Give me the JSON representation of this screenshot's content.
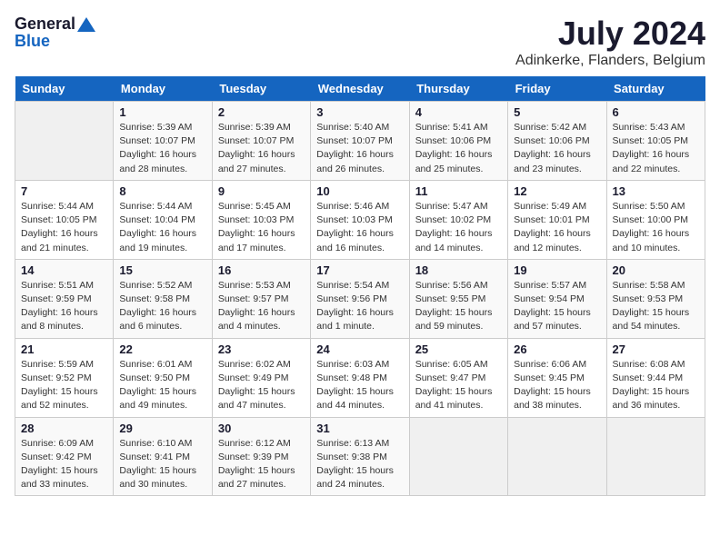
{
  "logo": {
    "general": "General",
    "blue": "Blue"
  },
  "title": {
    "month_year": "July 2024",
    "location": "Adinkerke, Flanders, Belgium"
  },
  "weekdays": [
    "Sunday",
    "Monday",
    "Tuesday",
    "Wednesday",
    "Thursday",
    "Friday",
    "Saturday"
  ],
  "weeks": [
    [
      {
        "day": "",
        "info": ""
      },
      {
        "day": "1",
        "info": "Sunrise: 5:39 AM\nSunset: 10:07 PM\nDaylight: 16 hours\nand 28 minutes."
      },
      {
        "day": "2",
        "info": "Sunrise: 5:39 AM\nSunset: 10:07 PM\nDaylight: 16 hours\nand 27 minutes."
      },
      {
        "day": "3",
        "info": "Sunrise: 5:40 AM\nSunset: 10:07 PM\nDaylight: 16 hours\nand 26 minutes."
      },
      {
        "day": "4",
        "info": "Sunrise: 5:41 AM\nSunset: 10:06 PM\nDaylight: 16 hours\nand 25 minutes."
      },
      {
        "day": "5",
        "info": "Sunrise: 5:42 AM\nSunset: 10:06 PM\nDaylight: 16 hours\nand 23 minutes."
      },
      {
        "day": "6",
        "info": "Sunrise: 5:43 AM\nSunset: 10:05 PM\nDaylight: 16 hours\nand 22 minutes."
      }
    ],
    [
      {
        "day": "7",
        "info": "Sunrise: 5:44 AM\nSunset: 10:05 PM\nDaylight: 16 hours\nand 21 minutes."
      },
      {
        "day": "8",
        "info": "Sunrise: 5:44 AM\nSunset: 10:04 PM\nDaylight: 16 hours\nand 19 minutes."
      },
      {
        "day": "9",
        "info": "Sunrise: 5:45 AM\nSunset: 10:03 PM\nDaylight: 16 hours\nand 17 minutes."
      },
      {
        "day": "10",
        "info": "Sunrise: 5:46 AM\nSunset: 10:03 PM\nDaylight: 16 hours\nand 16 minutes."
      },
      {
        "day": "11",
        "info": "Sunrise: 5:47 AM\nSunset: 10:02 PM\nDaylight: 16 hours\nand 14 minutes."
      },
      {
        "day": "12",
        "info": "Sunrise: 5:49 AM\nSunset: 10:01 PM\nDaylight: 16 hours\nand 12 minutes."
      },
      {
        "day": "13",
        "info": "Sunrise: 5:50 AM\nSunset: 10:00 PM\nDaylight: 16 hours\nand 10 minutes."
      }
    ],
    [
      {
        "day": "14",
        "info": "Sunrise: 5:51 AM\nSunset: 9:59 PM\nDaylight: 16 hours\nand 8 minutes."
      },
      {
        "day": "15",
        "info": "Sunrise: 5:52 AM\nSunset: 9:58 PM\nDaylight: 16 hours\nand 6 minutes."
      },
      {
        "day": "16",
        "info": "Sunrise: 5:53 AM\nSunset: 9:57 PM\nDaylight: 16 hours\nand 4 minutes."
      },
      {
        "day": "17",
        "info": "Sunrise: 5:54 AM\nSunset: 9:56 PM\nDaylight: 16 hours\nand 1 minute."
      },
      {
        "day": "18",
        "info": "Sunrise: 5:56 AM\nSunset: 9:55 PM\nDaylight: 15 hours\nand 59 minutes."
      },
      {
        "day": "19",
        "info": "Sunrise: 5:57 AM\nSunset: 9:54 PM\nDaylight: 15 hours\nand 57 minutes."
      },
      {
        "day": "20",
        "info": "Sunrise: 5:58 AM\nSunset: 9:53 PM\nDaylight: 15 hours\nand 54 minutes."
      }
    ],
    [
      {
        "day": "21",
        "info": "Sunrise: 5:59 AM\nSunset: 9:52 PM\nDaylight: 15 hours\nand 52 minutes."
      },
      {
        "day": "22",
        "info": "Sunrise: 6:01 AM\nSunset: 9:50 PM\nDaylight: 15 hours\nand 49 minutes."
      },
      {
        "day": "23",
        "info": "Sunrise: 6:02 AM\nSunset: 9:49 PM\nDaylight: 15 hours\nand 47 minutes."
      },
      {
        "day": "24",
        "info": "Sunrise: 6:03 AM\nSunset: 9:48 PM\nDaylight: 15 hours\nand 44 minutes."
      },
      {
        "day": "25",
        "info": "Sunrise: 6:05 AM\nSunset: 9:47 PM\nDaylight: 15 hours\nand 41 minutes."
      },
      {
        "day": "26",
        "info": "Sunrise: 6:06 AM\nSunset: 9:45 PM\nDaylight: 15 hours\nand 38 minutes."
      },
      {
        "day": "27",
        "info": "Sunrise: 6:08 AM\nSunset: 9:44 PM\nDaylight: 15 hours\nand 36 minutes."
      }
    ],
    [
      {
        "day": "28",
        "info": "Sunrise: 6:09 AM\nSunset: 9:42 PM\nDaylight: 15 hours\nand 33 minutes."
      },
      {
        "day": "29",
        "info": "Sunrise: 6:10 AM\nSunset: 9:41 PM\nDaylight: 15 hours\nand 30 minutes."
      },
      {
        "day": "30",
        "info": "Sunrise: 6:12 AM\nSunset: 9:39 PM\nDaylight: 15 hours\nand 27 minutes."
      },
      {
        "day": "31",
        "info": "Sunrise: 6:13 AM\nSunset: 9:38 PM\nDaylight: 15 hours\nand 24 minutes."
      },
      {
        "day": "",
        "info": ""
      },
      {
        "day": "",
        "info": ""
      },
      {
        "day": "",
        "info": ""
      }
    ]
  ]
}
